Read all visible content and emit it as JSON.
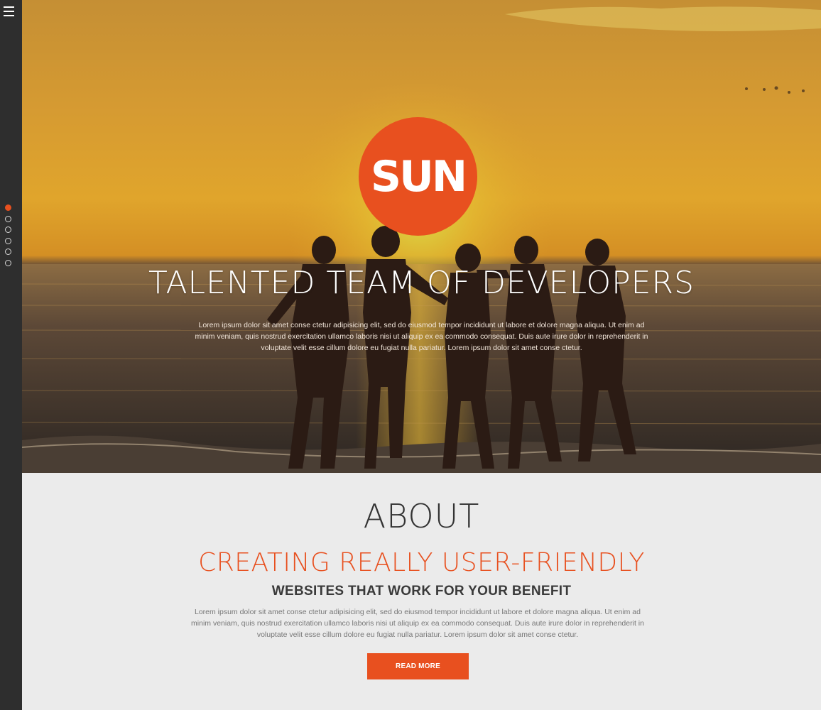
{
  "colors": {
    "accent": "#e8501f",
    "sidebar": "#2e2e2e",
    "about_bg": "#ebebeb"
  },
  "sidebar": {
    "menu_icon": "hamburger-menu-icon",
    "nav_dots": [
      {
        "active": true
      },
      {
        "active": false
      },
      {
        "active": false
      },
      {
        "active": false
      },
      {
        "active": false
      },
      {
        "active": false
      }
    ]
  },
  "hero": {
    "logo_text": "SUN",
    "title": "TALENTED TEAM OF DEVELOPERS",
    "text": "Lorem ipsum dolor sit amet conse ctetur adipisicing elit, sed do eiusmod tempor incididunt ut labore et dolore magna aliqua. Ut enim ad minim veniam, quis nostrud exercitation ullamco laboris nisi ut aliquip ex ea commodo consequat. Duis aute irure dolor in reprehenderit in voluptate velit esse cillum dolore eu fugiat nulla pariatur. Lorem ipsum dolor sit amet conse ctetur."
  },
  "about": {
    "title": "ABOUT",
    "subtitle": "CREATING REALLY USER-FRIENDLY",
    "tagline": "WEBSITES THAT WORK FOR YOUR BENEFIT",
    "text": "Lorem ipsum dolor sit amet conse ctetur adipisicing elit, sed do eiusmod tempor incididunt ut labore et dolore magna aliqua. Ut enim ad minim veniam, quis nostrud exercitation ullamco laboris nisi ut aliquip ex ea commodo consequat. Duis aute irure dolor in reprehenderit in voluptate velit esse cillum dolore eu fugiat nulla pariatur. Lorem ipsum dolor sit amet conse ctetur.",
    "button_label": "READ MORE"
  }
}
